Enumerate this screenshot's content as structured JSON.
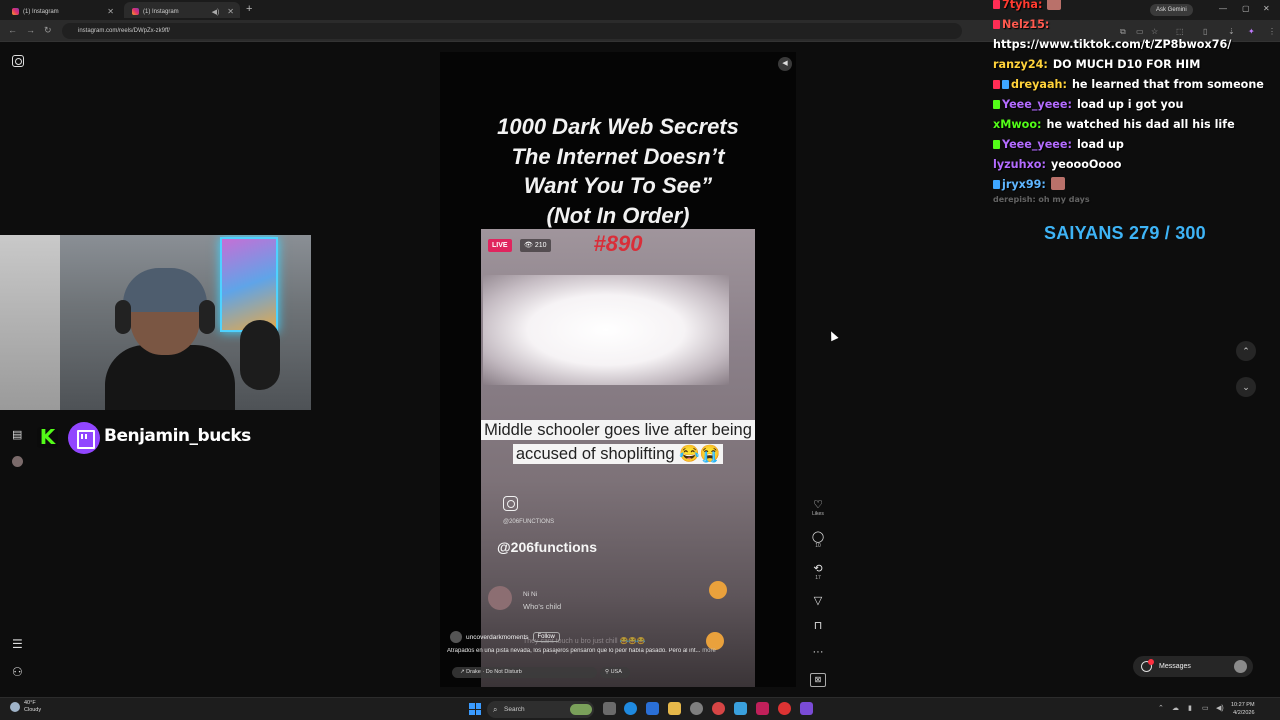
{
  "browser": {
    "tabs": [
      {
        "label": "(1) Instagram",
        "active": false
      },
      {
        "label": "(1) Instagram",
        "active": true
      }
    ],
    "url": "instagram.com/reels/DWpZx-zk9ff/",
    "ask_gemini": "Ask Gemini"
  },
  "chat": {
    "messages": [
      {
        "user": "7tyha:",
        "color": "#ff3b30",
        "text": "",
        "emote": true
      },
      {
        "user": "Nelz15:",
        "color": "#ff5a4f",
        "text": "",
        "badge": "#ff2d55"
      },
      {
        "user": "",
        "color": "#ffffff",
        "text": "https://www.tiktok.com/t/ZP8bwox76/"
      },
      {
        "user": "ranzy24:",
        "color": "#ffd23a",
        "text": "DO MUCH D10 FOR HIM"
      },
      {
        "user": "dreyaah:",
        "color": "#ffd23a",
        "text": "he learned that from someone",
        "badge": "#ff2d55",
        "badge2": "#3ea6ff"
      },
      {
        "user": "Yeee_yeee:",
        "color": "#b36bff",
        "text": "load up i got you",
        "badge": "#53fc18"
      },
      {
        "user": "xMwoo:",
        "color": "#53fc18",
        "text": "he watched his dad all his life"
      },
      {
        "user": "Yeee_yeee:",
        "color": "#b36bff",
        "text": "load up",
        "badge": "#53fc18"
      },
      {
        "user": "lyzuhxo:",
        "color": "#b36bff",
        "text": "yeoooOooo"
      },
      {
        "user": "jryx99:",
        "color": "#5fb6ff",
        "text": "",
        "badge": "#3ea6ff",
        "emote": true
      }
    ],
    "faded": "derepish: oh my days"
  },
  "goal": "SAIYANS 279 / 300",
  "streamer": {
    "name": "Benjamin_bucks",
    "kick_letter": "K"
  },
  "reel": {
    "title_lines": [
      "1000 Dark Web Secrets",
      "The Internet Doesn’t",
      "Want You To See”",
      "(Not In Order)"
    ],
    "episode": "#890",
    "live_label": "LIVE",
    "views": "210",
    "caption": "Middle schooler goes live after being accused of shoplifting 😂😭",
    "small_handle": "@206FUNCTIONS",
    "handle": "@206functions",
    "comment_user": "Ni Ni",
    "comment_text": "Who's child",
    "faint_comment": "They cant touch u bro just chill 😂😂😂",
    "account": "uncoverdarkmoments",
    "follow": "Follow",
    "description": "Atrapados en una pista nevada, los pasajeros pensaron que lo peor había pasado. Pero al int...",
    "more": "more",
    "audio": "Drake · Do Not Disturb",
    "location": "USA"
  },
  "actions": {
    "likes_label": "Likes",
    "comments": "10",
    "reposts": "17"
  },
  "messages_label": "Messages",
  "taskbar": {
    "temp": "40°F",
    "weather": "Cloudy",
    "search": "Search",
    "time": "10:27 PM",
    "date": "4/2/2026"
  }
}
